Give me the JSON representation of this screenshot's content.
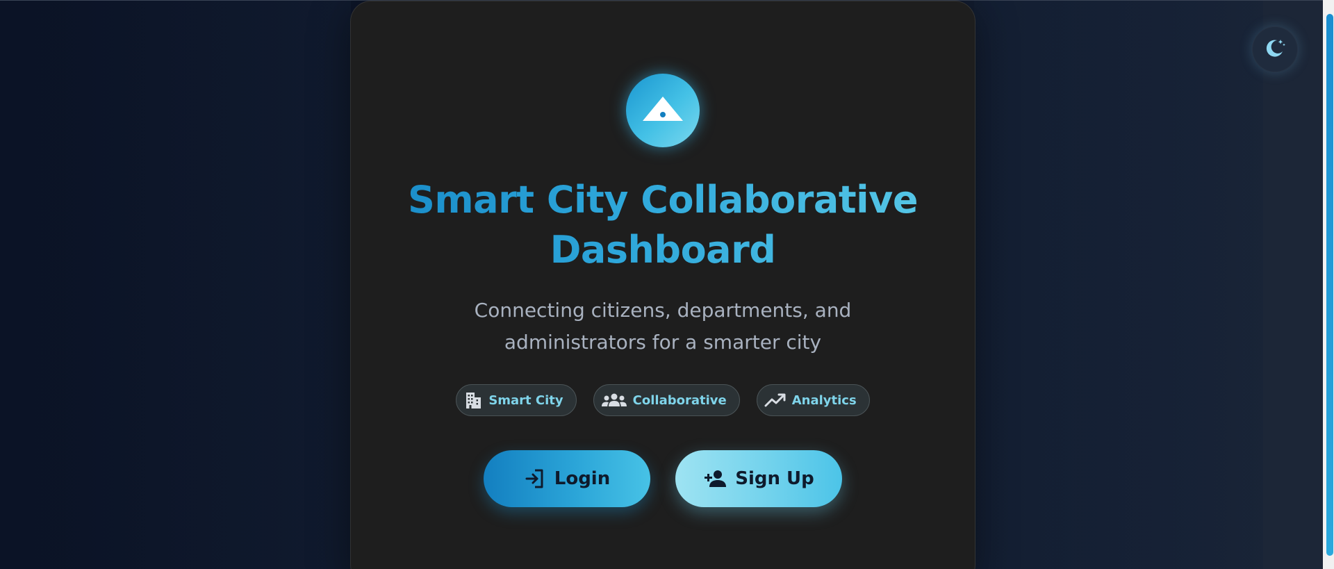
{
  "app": {
    "title": "Smart City Collaborative Dashboard",
    "title_line1": "Smart City Collaborative",
    "title_line2": "Dashboard",
    "subtitle_line1": "Connecting citizens, departments, and",
    "subtitle_line2": "administrators for a smarter city"
  },
  "tags": [
    {
      "label": "Smart City",
      "icon": "city-buildings-icon"
    },
    {
      "label": "Collaborative",
      "icon": "users-group-icon"
    },
    {
      "label": "Analytics",
      "icon": "trending-up-icon"
    }
  ],
  "actions": {
    "login_label": "Login",
    "login_icon": "login-icon",
    "signup_label": "Sign Up",
    "signup_icon": "user-plus-icon"
  },
  "theme_toggle": {
    "icon": "moon-stars-icon",
    "mode": "dark"
  },
  "colors": {
    "page_background": "#0e1629",
    "card_background": "#1e1e1e",
    "accent": "#2ba5d8",
    "accent_light": "#7fd4ea",
    "subtitle_text": "#a9b2c0"
  }
}
